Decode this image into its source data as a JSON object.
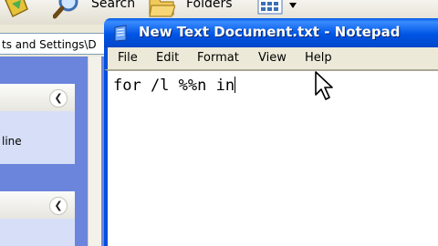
{
  "explorer": {
    "toolbar": {
      "search_label": "Search",
      "folders_label": "Folders"
    },
    "address_text": "ts and Settings\\D",
    "tasks_link_partial": "line"
  },
  "notepad": {
    "title": "New Text Document.txt - Notepad",
    "menu": [
      "File",
      "Edit",
      "Format",
      "View",
      "Help"
    ],
    "content": "for /l %%n in"
  },
  "colors": {
    "title_bar": "#0055e5",
    "explorer_pane": "#6b85dc",
    "window_face": "#ece9d8"
  },
  "icons": [
    "back-arrow-icon",
    "search-icon",
    "folders-icon",
    "views-icon",
    "chevron-down-icon",
    "collapse-icon",
    "notepad-icon",
    "mouse-cursor-icon"
  ]
}
